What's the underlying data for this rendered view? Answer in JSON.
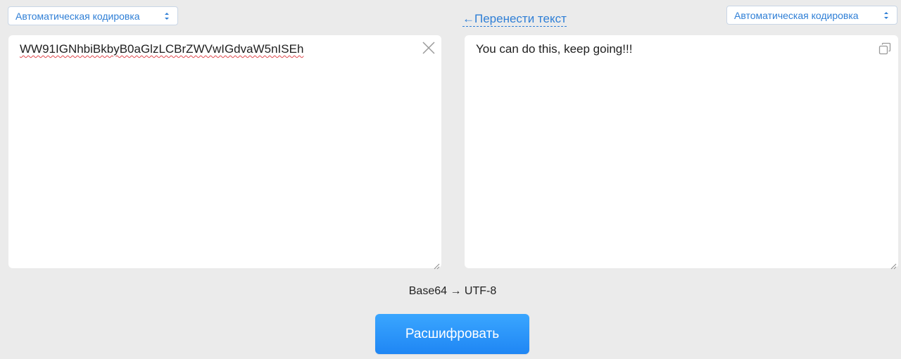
{
  "encoding": {
    "left_select": "Автоматическая кодировка",
    "right_select": "Автоматическая кодировка"
  },
  "swap_link": "←Перенести текст",
  "input": {
    "value": "WW91IGNhbiBkbyB0aGlzLCBrZWVwIGdvaW5nISEh"
  },
  "output": {
    "value": "You can do this, keep going!!!"
  },
  "direction_label": "Base64 → UTF-8",
  "decode_button": "Расшифровать",
  "colors": {
    "accent": "#2f7fd6",
    "button": "#2290f8",
    "background": "#ebebeb"
  }
}
